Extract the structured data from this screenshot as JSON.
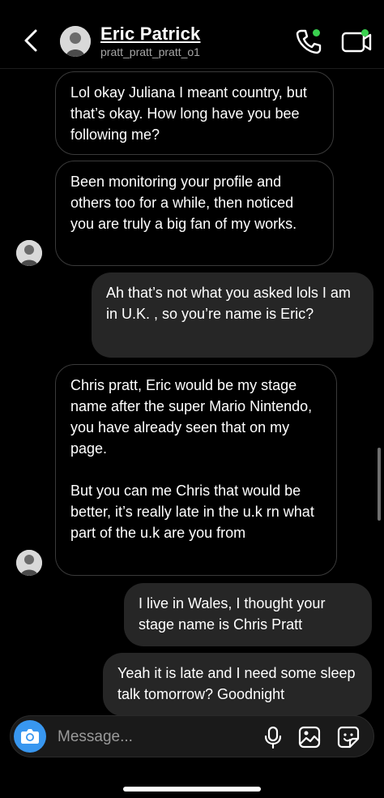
{
  "header": {
    "title": "Eric Patrick",
    "subtitle": "pratt_pratt_pratt_o1"
  },
  "messages": [
    {
      "from": "them",
      "text": "Lol okay Juliana I meant country, but that’s okay. How long have you bee following me?"
    },
    {
      "from": "them",
      "text": "Been monitoring your profile and others too for a while, then noticed you are truly a big fan of my works."
    },
    {
      "from": "me",
      "text": "Ah that’s not what you asked lols I am in U.K. , so you’re name is Eric?"
    },
    {
      "from": "them",
      "text_p1": "Chris pratt, Eric would be my stage name after the super Mario Nintendo, you have already seen that on my page.",
      "text_p2": "But you can me Chris that would be better, it’s really late in the u.k rn what part of the u.k are you from"
    },
    {
      "from": "me",
      "text": "I live in Wales, I thought your stage name is Chris Pratt"
    },
    {
      "from": "me",
      "text": "Yeah it is late and I need some sleep talk tomorrow? Goodnight"
    }
  ],
  "composer": {
    "placeholder": "Message..."
  },
  "colors": {
    "online": "#3ad04f",
    "camera": "#3897f0",
    "outgoing_bubble": "#262626"
  },
  "icons": [
    "back-chevron-icon",
    "voice-call-icon",
    "video-call-icon",
    "camera-icon",
    "microphone-icon",
    "gallery-icon",
    "sticker-icon"
  ]
}
